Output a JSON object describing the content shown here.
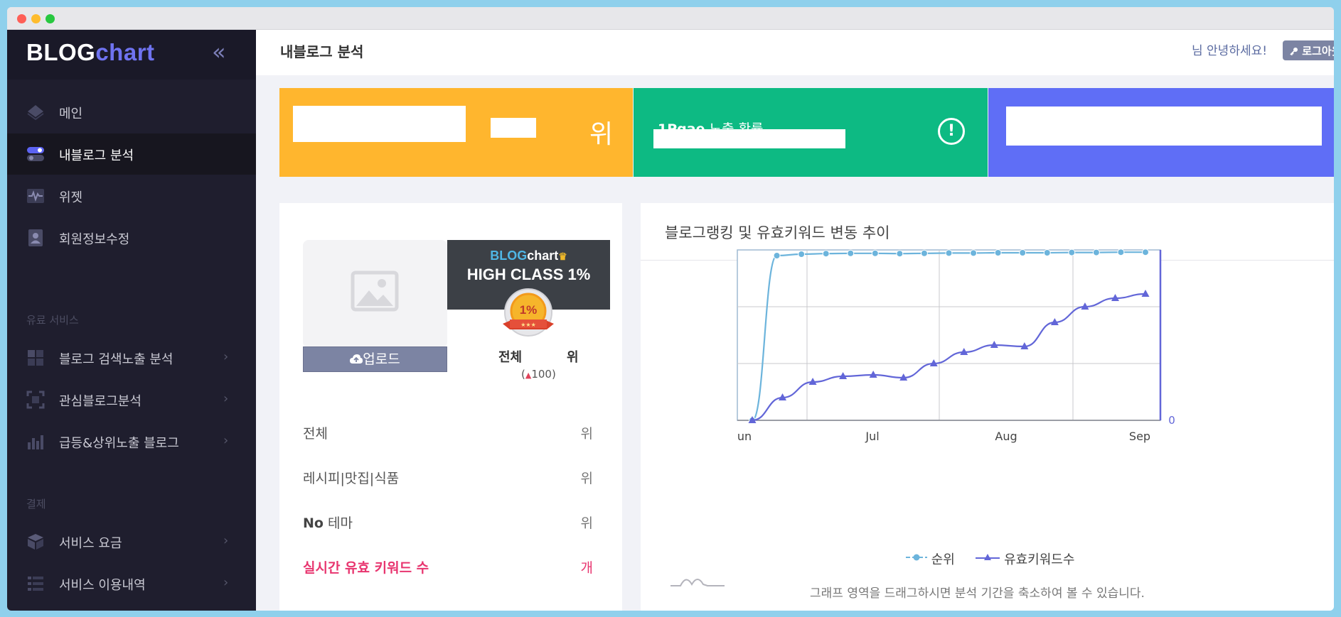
{
  "sidebar": {
    "logo_part1": "BLOG",
    "logo_part2": "chart",
    "collapse_icon": "«",
    "items": [
      {
        "label": "메인",
        "icon": "layers-icon"
      },
      {
        "label": "내블로그 분석",
        "icon": "toggle-icon"
      },
      {
        "label": "위젯",
        "icon": "pulse-icon"
      },
      {
        "label": "회원정보수정",
        "icon": "profile-card-icon"
      }
    ],
    "section_paid": "유료 서비스",
    "paid_items": [
      {
        "label": "블로그 검색노출 분석",
        "icon": "grid-icon"
      },
      {
        "label": "관심블로그분석",
        "icon": "focus-icon"
      },
      {
        "label": "급등&상위노출 블로그",
        "icon": "bar-chart-icon"
      }
    ],
    "section_payment": "결제",
    "payment_items": [
      {
        "label": "서비스 요금",
        "icon": "cube-icon"
      },
      {
        "label": "서비스 이용내역",
        "icon": "list-icon"
      }
    ],
    "chevron": "›"
  },
  "header": {
    "title": "내블로그 분석",
    "greeting": "님 안녕하세요!",
    "logout": "로그아웃",
    "logout_icon": "key-icon"
  },
  "cards": {
    "rank_unit": "위",
    "exposure_title_bold": "1Pgae",
    "exposure_title_rest": " 노출 확률",
    "alert_icon": "!"
  },
  "profile": {
    "upload": "업로드",
    "badge_logo_1": "BLOG",
    "badge_logo_2": "chart",
    "badge_class": "HIGH CLASS 1%",
    "medal_text": "1%",
    "total_label": "전체",
    "total_unit": "위",
    "total_change_arrow": "▲",
    "total_change_value": "100",
    "stats": [
      {
        "label": "전체",
        "unit": "위"
      },
      {
        "label": "레시피|맛집|식품",
        "unit": "위"
      },
      {
        "label_bold": "No",
        "label_rest": " 테마",
        "unit": "위"
      },
      {
        "label": "실시간 유효 키워드 수",
        "unit": "개"
      }
    ]
  },
  "chart_panel": {
    "title": "블로그랭킹 및 유효키워드 변동 추이",
    "legend_rank": "순위",
    "legend_keywords": "유효키워드수",
    "hint": "그래프 영역을 드래그하시면 분석 기간을 축소하여 볼 수 있습니다."
  },
  "chart_data": {
    "type": "line",
    "x_tick_labels": [
      "un",
      "Jul",
      "Aug",
      "Sep"
    ],
    "right_axis_tick": "0",
    "ylim": [
      0,
      6
    ],
    "grid": true,
    "legend_position": "bottom",
    "series": [
      {
        "name": "순위",
        "color": "#6cb4dc",
        "marker": "circle",
        "values": [
          0,
          5.8,
          5.85,
          5.87,
          5.88,
          5.88,
          5.87,
          5.88,
          5.89,
          5.89,
          5.9,
          5.9,
          5.9,
          5.91,
          5.91,
          5.92,
          5.92
        ]
      },
      {
        "name": "유효키워드수",
        "color": "#6266d8",
        "marker": "triangle",
        "values": [
          0,
          0.8,
          1.35,
          1.55,
          1.6,
          1.5,
          2.0,
          2.4,
          2.65,
          2.6,
          3.45,
          4.0,
          4.3,
          4.45
        ]
      }
    ]
  }
}
